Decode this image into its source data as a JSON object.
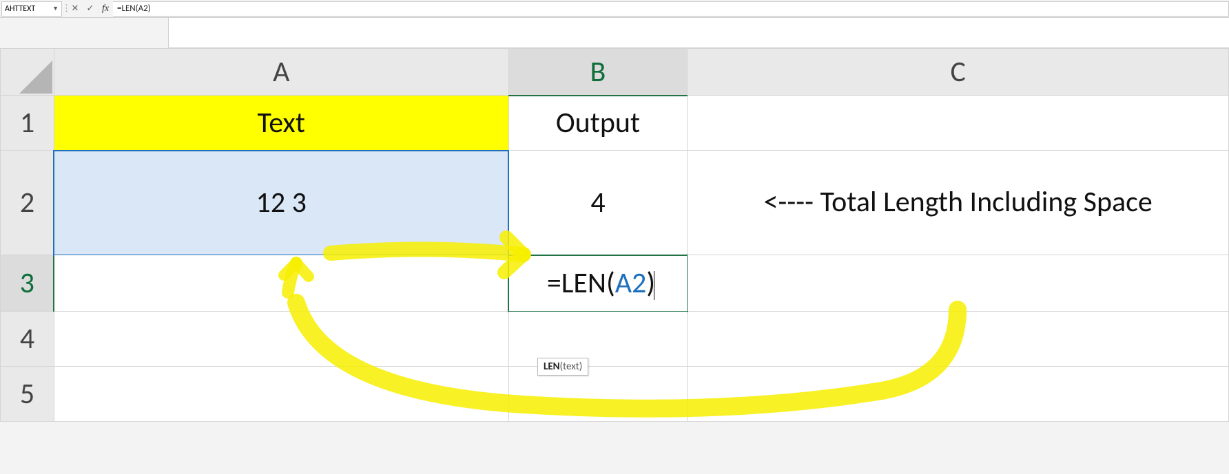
{
  "formula_bar": {
    "name_box": "AHTTEXT",
    "cancel_glyph": "✕",
    "enter_glyph": "✓",
    "fx_glyph": "fx",
    "formula_text": "=LEN(A2)"
  },
  "columns": {
    "A": "A",
    "B": "B",
    "C": "C"
  },
  "rows": {
    "1": "1",
    "2": "2",
    "3": "3",
    "4": "4",
    "5": "5"
  },
  "cells": {
    "A1": "Text",
    "B1": "Output",
    "A2": "12 3",
    "B2": "4",
    "C2": "<---- Total Length Including Space",
    "B3_prefix": "=LEN(",
    "B3_ref": "A2",
    "B3_suffix": ")"
  },
  "tooltip": {
    "fn": "LEN",
    "arg": "(text)"
  }
}
